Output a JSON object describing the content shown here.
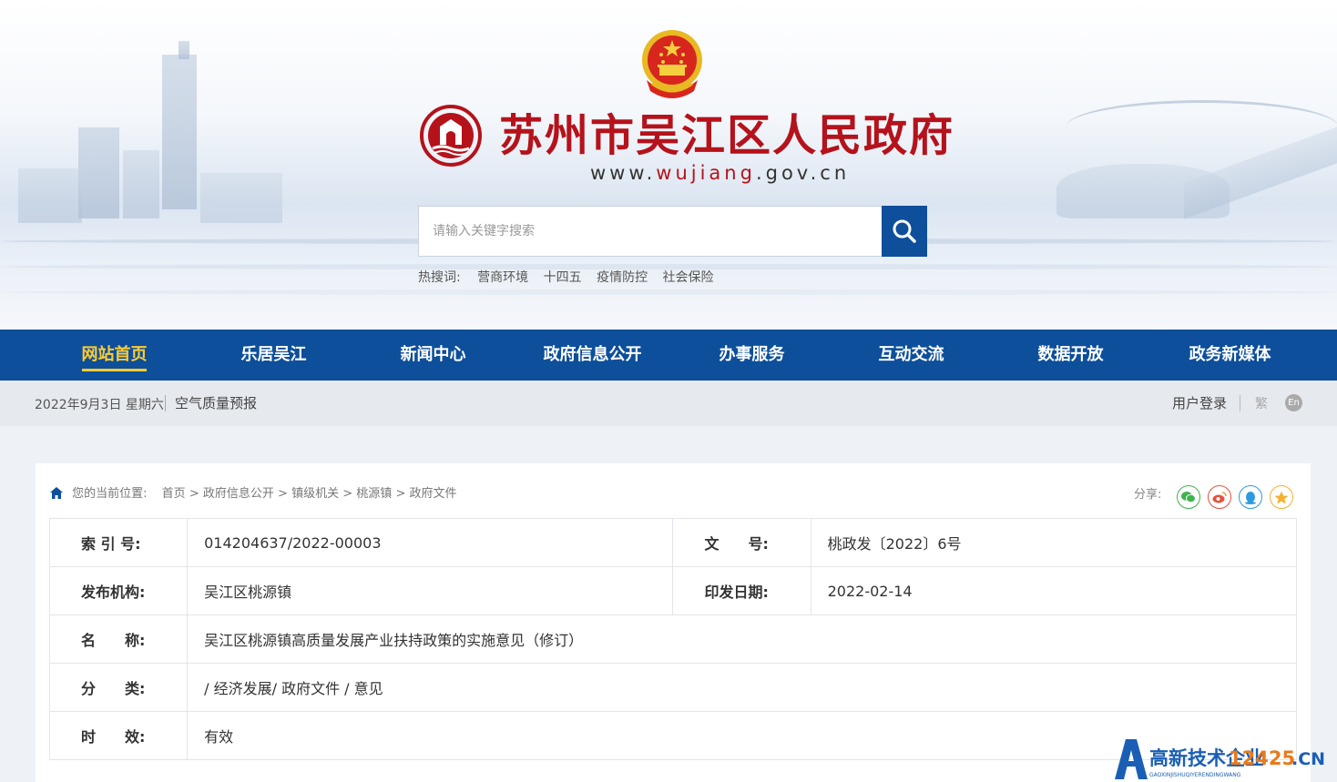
{
  "header": {
    "title": "苏州市吴江区人民政府",
    "url_prefix": "www.",
    "url_highlight": "wujiang",
    "url_suffix": ".gov.cn",
    "search_placeholder": "请输入关键字搜索",
    "hot_label": "热搜词:",
    "hot_words": [
      "营商环境",
      "十四五",
      "疫情防控",
      "社会保险"
    ],
    "accent_color": "#b5121b"
  },
  "nav": {
    "items": [
      "网站首页",
      "乐居吴江",
      "新闻中心",
      "政府信息公开",
      "办事服务",
      "互动交流",
      "数据开放",
      "政务新媒体"
    ],
    "active_index": 0,
    "bg_color": "#0d4f9a"
  },
  "infobar": {
    "date": "2022年9月3日 星期六",
    "air_quality": "空气质量预报",
    "login": "用户登录",
    "traditional": "繁",
    "english": "En"
  },
  "breadcrumb": {
    "label": "您的当前位置:",
    "items": [
      "首页",
      "政府信息公开",
      "镇级机关",
      "桃源镇",
      "政府文件"
    ],
    "separator": ">"
  },
  "share": {
    "label": "分享:",
    "icons": [
      "wechat-icon",
      "weibo-icon",
      "qq-icon",
      "favorite-icon"
    ]
  },
  "meta": {
    "index_key": "索 引 号:",
    "index_val": "014204637/2022-00003",
    "doc_key": "文　　号:",
    "doc_val": "桃政发〔2022〕6号",
    "org_key": "发布机构:",
    "org_val": "吴江区桃源镇",
    "date_key": "印发日期:",
    "date_val": "2022-02-14",
    "name_key": "名　　称:",
    "name_val": "吴江区桃源镇高质量发展产业扶持政策的实施意见（修订）",
    "cat_key": "分　　类:",
    "cat_val": "/ 经济发展/ 政府文件 / 意见",
    "valid_key": "时　　效:",
    "valid_val": "有效"
  },
  "watermark": {
    "main": "高新技术企业",
    "num": "12425",
    "tld": ".CN",
    "sub": "GAOXINJISHUQIYERENDINGWANG"
  }
}
